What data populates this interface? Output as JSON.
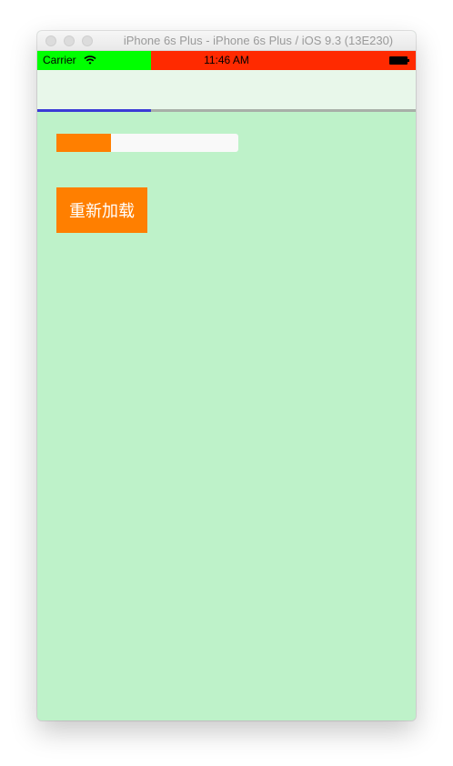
{
  "window": {
    "title": "iPhone 6s Plus - iPhone 6s Plus / iOS 9.3 (13E230)"
  },
  "status_bar": {
    "carrier": "Carrier",
    "time": "11:46 AM",
    "icons": [
      "wifi-icon",
      "battery-icon"
    ]
  },
  "web_load_progress": {
    "fraction": 0.3
  },
  "progress_view": {
    "fraction": 0.3
  },
  "reload_button": {
    "label": "重新加载"
  },
  "colors": {
    "content_background": "#bef2c9",
    "status_left": "#00ff00",
    "status_right": "#ff2a00",
    "accent": "#ff7f00",
    "load_progress": "#3b3bd6"
  }
}
